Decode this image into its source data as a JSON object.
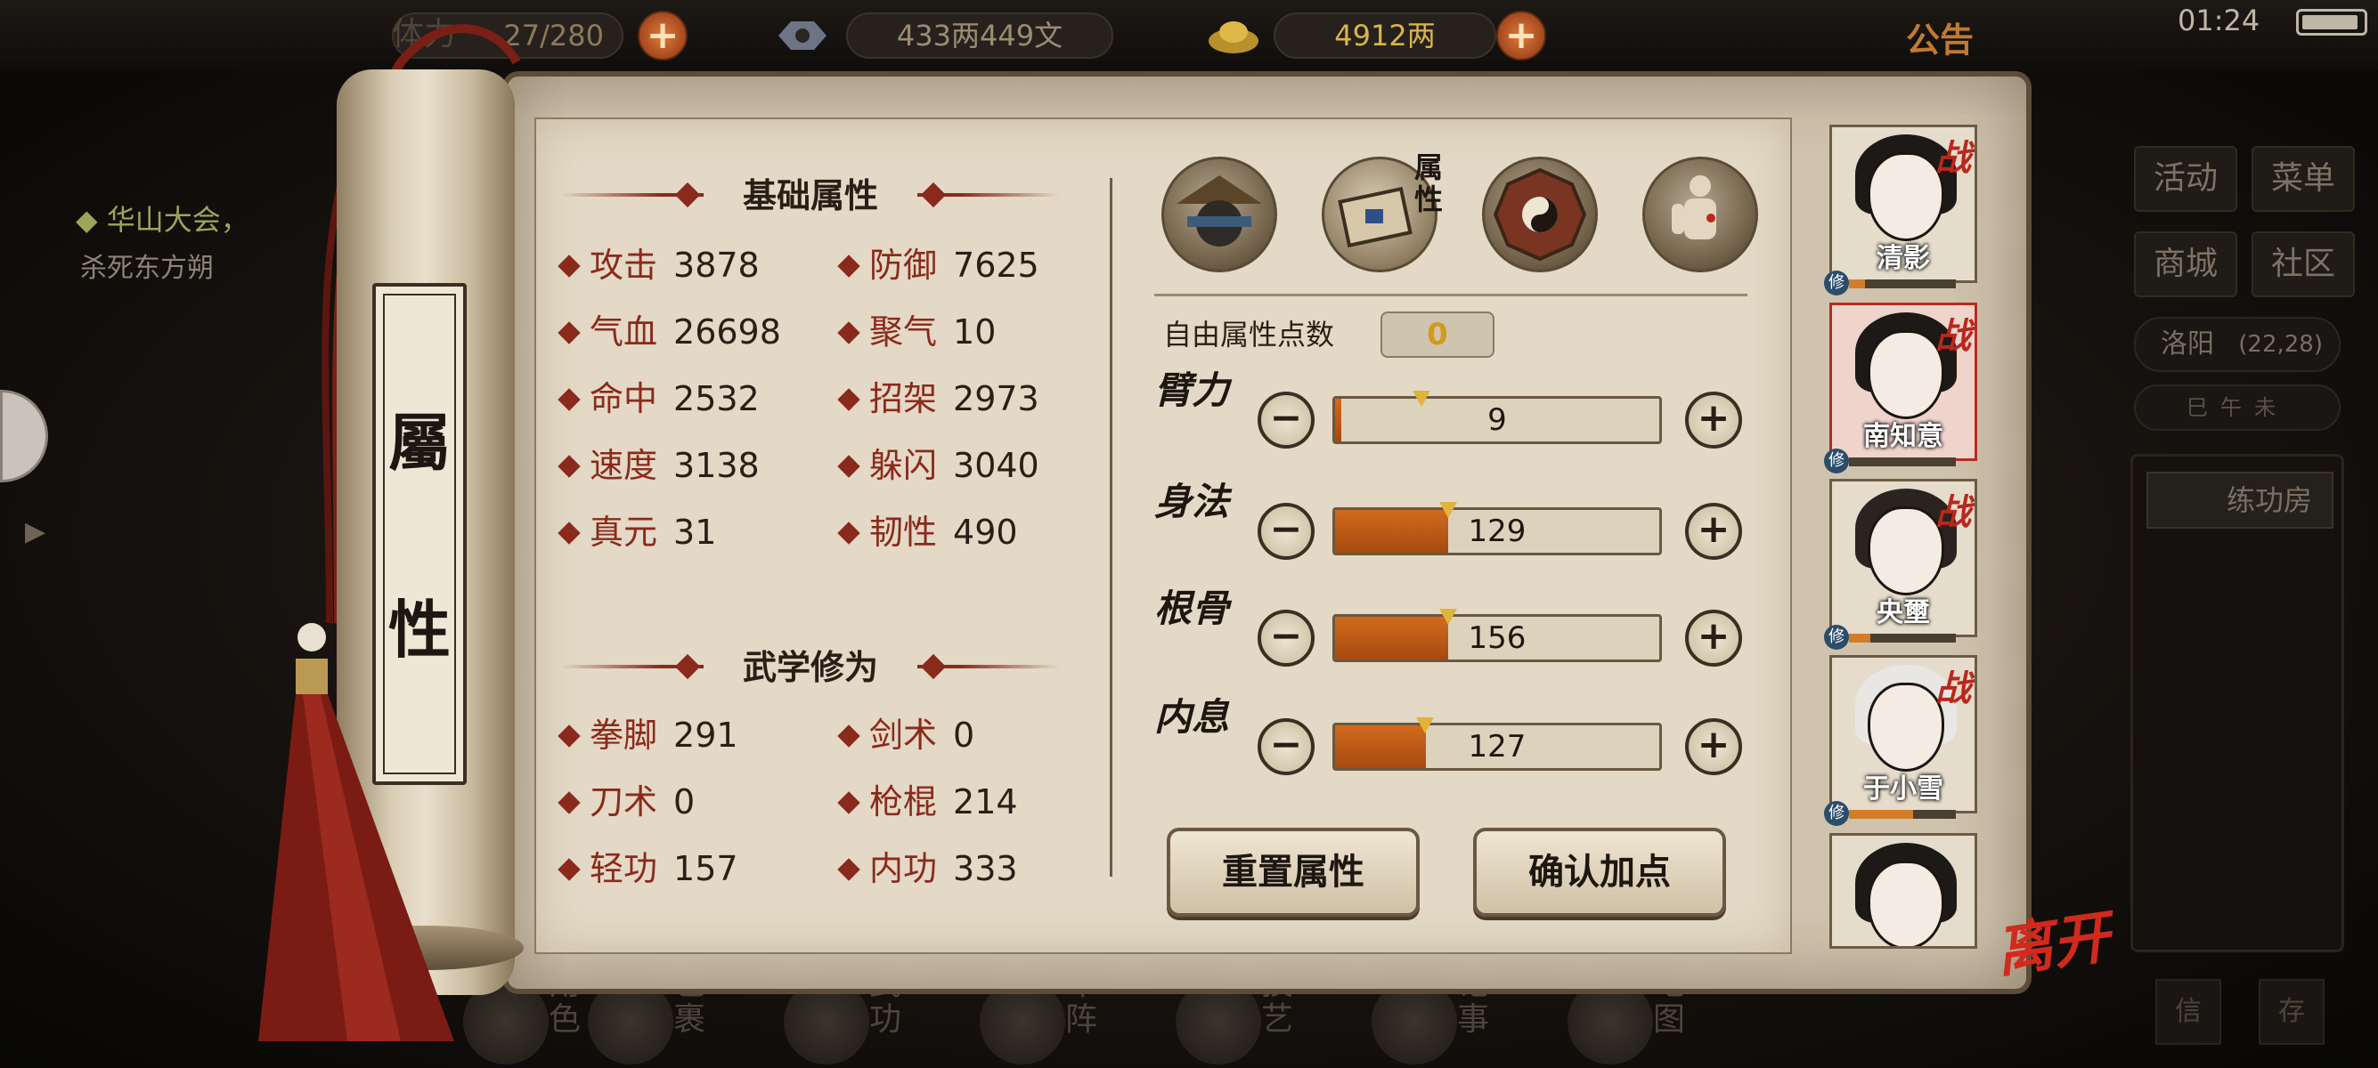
{
  "topbar": {
    "stamina_label": "体力",
    "stamina": "27/280",
    "copper": "433两449文",
    "gold": "4912两",
    "notice": "公告",
    "clock": "01:24"
  },
  "quest": {
    "title": "◆ 华山大会，",
    "desc": "杀死东方朔"
  },
  "right_panel": {
    "activity": "活动",
    "menu": "菜单",
    "shop": "商城",
    "community": "社区",
    "location": "洛阳",
    "coords": "(22,28)",
    "time_scale": "巳午未",
    "room": "练功房",
    "small_1": "信",
    "small_2": "存"
  },
  "bottom_nav": [
    {
      "label": "角色"
    },
    {
      "label": "包裹"
    },
    {
      "label": "武功"
    },
    {
      "label": "布阵"
    },
    {
      "label": "技艺"
    },
    {
      "label": "记事"
    },
    {
      "label": "地图"
    }
  ],
  "scroll": {
    "char1": "屬",
    "char2": "性"
  },
  "basic": {
    "title": "基础属性",
    "stats": [
      {
        "name": "攻击",
        "value": "3878"
      },
      {
        "name": "防御",
        "value": "7625"
      },
      {
        "name": "气血",
        "value": "26698"
      },
      {
        "name": "聚气",
        "value": "10"
      },
      {
        "name": "命中",
        "value": "2532"
      },
      {
        "name": "招架",
        "value": "2973"
      },
      {
        "name": "速度",
        "value": "3138"
      },
      {
        "name": "躲闪",
        "value": "3040"
      },
      {
        "name": "真元",
        "value": "31"
      },
      {
        "name": "韧性",
        "value": "490"
      }
    ]
  },
  "martial": {
    "title": "武学修为",
    "stats": [
      {
        "name": "拳脚",
        "value": "291"
      },
      {
        "name": "剑术",
        "value": "0"
      },
      {
        "name": "刀术",
        "value": "0"
      },
      {
        "name": "枪棍",
        "value": "214"
      },
      {
        "name": "轻功",
        "value": "157"
      },
      {
        "name": "内功",
        "value": "333"
      }
    ]
  },
  "tabs": {
    "active_label": "属性"
  },
  "free_points": {
    "label": "自由属性点数",
    "value": "0"
  },
  "attributes": [
    {
      "name": "臂力",
      "value": "9",
      "fill": 0.02
    },
    {
      "name": "身法",
      "value": "129",
      "fill": 0.35
    },
    {
      "name": "根骨",
      "value": "156",
      "fill": 0.35
    },
    {
      "name": "内息",
      "value": "127",
      "fill": 0.28
    }
  ],
  "buttons": {
    "reset": "重置属性",
    "confirm": "确认加点",
    "minus": "−",
    "plus": "+"
  },
  "characters": [
    {
      "name": "清影",
      "zhan": "战",
      "xiu": "修",
      "xiu_fill": 0.15
    },
    {
      "name": "南知意",
      "zhan": "战",
      "xiu": "修",
      "xiu_fill": 0.0
    },
    {
      "name": "央壐",
      "zhan": "战",
      "xiu": "修",
      "xiu_fill": 0.2
    },
    {
      "name": "于小雪",
      "zhan": "战",
      "xiu": "修",
      "xiu_fill": 0.6
    },
    {
      "name": "",
      "zhan": "",
      "xiu": "",
      "xiu_fill": 0
    }
  ],
  "leave": "离开",
  "colors": {
    "accent_red": "#8a2a1c",
    "bar_orange": "#d26a1e",
    "gold": "#d9b54a"
  }
}
